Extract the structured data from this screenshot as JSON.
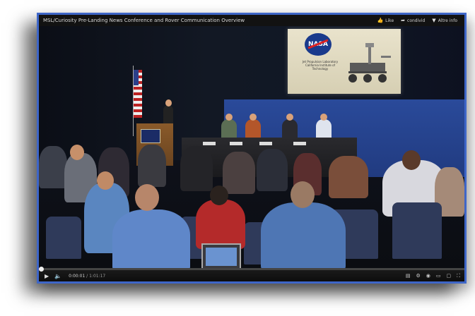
{
  "player": {
    "title": "MSL/Curiosity Pre-Landing News Conference and Rover Communication Overview",
    "actions": [
      {
        "icon": "thumbs-up-icon",
        "label": "Like"
      },
      {
        "icon": "share-icon",
        "label": "condivid"
      },
      {
        "icon": "info-icon",
        "label": "Altre info"
      }
    ],
    "accent_color": "#3e66c8"
  },
  "screen_slide": {
    "logo_text": "NASA",
    "caption": "Jet Propulsion Laboratory California Institute of Technology"
  },
  "controls": {
    "current_time": "0:00:01",
    "separator": " / ",
    "duration": "1:01:17",
    "progress_fraction": 0.005,
    "icons": [
      "play-icon",
      "volume-icon",
      "captions-icon",
      "settings-icon",
      "annotations-icon",
      "small-player-icon",
      "large-player-icon",
      "fullscreen-icon"
    ]
  }
}
